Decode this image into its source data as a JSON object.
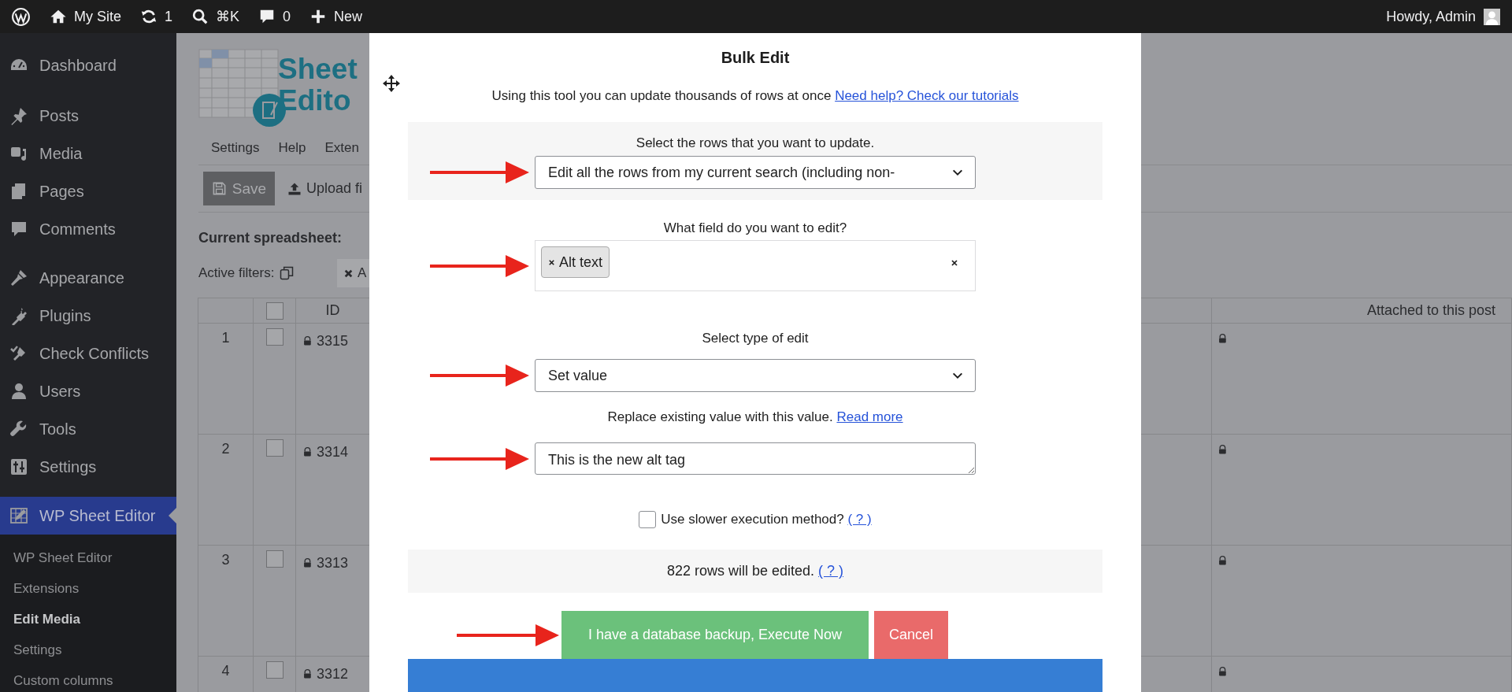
{
  "admin_bar": {
    "items": [
      {
        "kind": "wordpress"
      },
      {
        "kind": "home",
        "label": "My Site"
      },
      {
        "kind": "updates",
        "label": "1"
      },
      {
        "kind": "search",
        "label": "⌘K"
      },
      {
        "kind": "comments",
        "label": "0"
      },
      {
        "kind": "new",
        "label": "New"
      }
    ],
    "greeting": "Howdy, Admin"
  },
  "sidebar": {
    "sections": [
      {
        "items": [
          {
            "kind": "dashboard",
            "label": "Dashboard",
            "selected": false
          }
        ]
      },
      {
        "items": [
          {
            "kind": "posts",
            "label": "Posts",
            "selected": false
          },
          {
            "kind": "media",
            "label": "Media",
            "selected": false
          },
          {
            "kind": "pages",
            "label": "Pages",
            "selected": false
          },
          {
            "kind": "comments",
            "label": "Comments",
            "selected": false
          }
        ]
      },
      {
        "items": [
          {
            "kind": "appearance",
            "label": "Appearance",
            "selected": false
          },
          {
            "kind": "plugins",
            "label": "Plugins",
            "selected": false
          },
          {
            "kind": "conflicts",
            "label": "Check Conflicts",
            "selected": false
          },
          {
            "kind": "users",
            "label": "Users",
            "selected": false
          },
          {
            "kind": "tools",
            "label": "Tools",
            "selected": false
          },
          {
            "kind": "settings",
            "label": "Settings",
            "selected": false
          }
        ]
      },
      {
        "items": [
          {
            "kind": "sheet",
            "label": "WP Sheet Editor",
            "selected": true
          }
        ]
      }
    ],
    "submenu": [
      {
        "label": "WP Sheet Editor",
        "selected": false
      },
      {
        "label": "Extensions",
        "selected": false
      },
      {
        "label": "Edit Media",
        "selected": true
      },
      {
        "label": "Settings",
        "selected": false
      },
      {
        "label": "Custom columns",
        "selected": false
      }
    ]
  },
  "background": {
    "logo_lines": [
      "Sheet",
      "Edito"
    ],
    "menu": [
      "Settings",
      "Help",
      "Exten"
    ],
    "toolbar": [
      {
        "kind": "save",
        "label": "Save"
      },
      {
        "kind": "upload",
        "label": "Upload fi"
      }
    ],
    "current_spreadsheet": "Current spreadsheet:",
    "filters": {
      "label": "Active filters:",
      "chip": "A"
    },
    "table": {
      "columns": [
        "ID",
        "Attached to this post"
      ],
      "select_all": {
        "checked": false
      },
      "rows": [
        {
          "number": "1",
          "checked": false,
          "id": "3315"
        },
        {
          "number": "2",
          "checked": false,
          "id": "3314"
        },
        {
          "number": "3",
          "checked": false,
          "id": "3313"
        },
        {
          "number": "4",
          "checked": false,
          "id": "3312"
        }
      ]
    }
  },
  "modal": {
    "title": "Bulk Edit",
    "intro": "Using this tool you can update thousands of rows at once",
    "intro_link": "Need help? Check our tutorials",
    "rows_select": {
      "label": "Select the rows that you want to update.",
      "value": "Edit all the rows from my current search (including non-"
    },
    "field_select": {
      "label": "What field do you want to edit?",
      "tags": [
        "Alt text"
      ]
    },
    "edit_type": {
      "label": "Select type of edit",
      "value": "Set value"
    },
    "hint": "Replace existing value with this value.",
    "hint_link": "Read more",
    "value_field": {
      "value": "This is the new alt tag"
    },
    "slower": {
      "label": "Use slower execution method?",
      "link": "( ? )",
      "checked": false
    },
    "summary": {
      "text": "822 rows will be edited.",
      "link": "( ? )"
    },
    "buttons": [
      {
        "kind": "execute",
        "label": "I have a database backup, Execute Now"
      },
      {
        "kind": "cancel",
        "label": "Cancel"
      }
    ]
  }
}
